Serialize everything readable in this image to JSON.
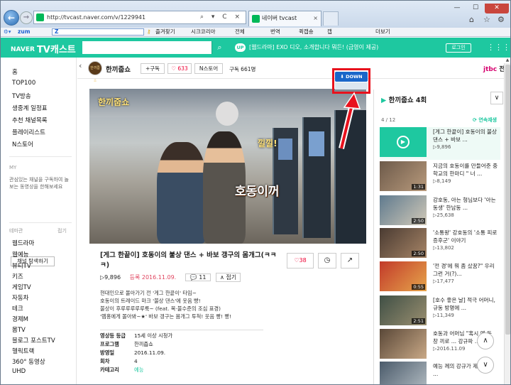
{
  "browser": {
    "url": "http://tvcast.naver.com/v/1229941",
    "tab_title": "네이버 tvcast",
    "tab_close": "×",
    "back_glyph": "←",
    "forward_glyph": "→",
    "addr_controls": "⌕ ▾ C ×",
    "min_glyph": "—",
    "max_glyph": "☐",
    "close_glyph": "✕"
  },
  "toolbar": {
    "zum": "zum",
    "z_label": "Z",
    "items": [
      "즐겨찾기",
      "시크코리아",
      "전체",
      "번역",
      "퀵캡숑",
      "캡",
      "더보기"
    ]
  },
  "site_header": {
    "logo_naver": "NAVER",
    "logo_service": "TV캐스트",
    "search_placeholder": "",
    "search_glyph": "⌕",
    "up_badge": "UP",
    "up_text": "[웹드라마] EXO 디오, 소개합니다 뭐든! (금영이 제공)",
    "login": "로그인",
    "grid_glyph": "⋮⋮⋮"
  },
  "sidebar": {
    "items": [
      "홈",
      "TOP100",
      "TV방송",
      "생중계 일정표",
      "추천 채널목록",
      "플레이리스트",
      "N스토어"
    ],
    "my_label": "MY",
    "my_desc": "관심있는 채널을 구독하여 놀 보는 동영상을 한해보세요",
    "channel_btn": "채널 탐색하기",
    "theme_label": "테마관",
    "theme_fold": "접기",
    "theme_items": [
      "웹드라마",
      "웹예능",
      "뷰티TV",
      "키즈",
      "게임TV",
      "자동차",
      "테크",
      "경제M",
      "몸TV",
      "블로그 포스트TV",
      "헬릭트랙",
      "360° 동영상",
      "UHD"
    ]
  },
  "channel": {
    "name": "한끼줍쇼",
    "logo_text": "한끼줍쇼",
    "subscribe": "+구독",
    "likes": "♡ 633",
    "nstore": "N스토어",
    "subscribers": "구독 661명",
    "broadcaster": "jtbc",
    "broadcaster_rest": " 전체보기",
    "prev_glyph": "‹"
  },
  "player": {
    "watermark": "한끼줍쇼",
    "caption_top": "낄낄!",
    "caption_main": "호동이꺼",
    "download_label": "DOWN"
  },
  "video": {
    "title": "[게그 한끝이] 호동이의 불상 댄스 + 바보 갱구의 몸개그(ㅋㅋㅋ)",
    "views": "▷9,896",
    "date": "등록 2016.11.09.",
    "comments": "11",
    "fold": "∧ 접기",
    "like_count": "♡38",
    "clock_glyph": "◷",
    "share_glyph": "↗",
    "desc": [
      "현대인으로 몰아가기 전 '게그 한끝이' 타임~",
      "호동이의 트레이드 마크 '불상 댄스'에 웃음 빵!",
      "불상이 후루루루루루룩~ (feat. 목·불수준의 조심 표경)",
      "'멤홍에게 몰아봐~★' 바보 갱구는 몸개그 투척! 웃음 빵! 빵!"
    ],
    "info": [
      {
        "k": "영상등 등급",
        "v": "15세 이상 시청가"
      },
      {
        "k": "프로그램",
        "v": "한끼줍쇼"
      },
      {
        "k": "방영일",
        "v": "2016.11.09."
      },
      {
        "k": "회차",
        "v": "4"
      },
      {
        "k": "카테고리",
        "v": "예능"
      }
    ]
  },
  "playlist": {
    "title": "한끼줍쇼 4회",
    "title_badge": "",
    "count": "4 / 12",
    "autoplay": "연속재생",
    "collapse_glyph": "∨",
    "items": [
      {
        "title": "[게그 한끝이] 호동이의 불상 댄스 + 바보 ...",
        "views": "▷9,896",
        "dur": "",
        "current": true
      },
      {
        "title": "지금의 호동이를 만들어준 중학교의 한마디 \" 너 ...",
        "views": "▷8,149",
        "dur": "1:31",
        "current": false
      },
      {
        "title": "강호동, 아는 형님보다 '아는 동생' 한남동 ...",
        "views": "▷25,638",
        "dur": "2:50",
        "current": false
      },
      {
        "title": "'소통왕' 강호동의 '소통 피로증후군' 이야기",
        "views": "▷13,802",
        "dur": "2:50",
        "current": false
      },
      {
        "title": "'전 경'에 뭐 좀 샀꿈?\" 우리 그런 거(?)...",
        "views": "▷17,477",
        "dur": "0:55",
        "current": false
      },
      {
        "title": "[호수 좋은 날] 적극 어머니, 규동 방명에 ...",
        "views": "▷11,349",
        "dur": "2:51",
        "current": false
      },
      {
        "title": "호동과 어머님 \"혹시 옛 동창 끼로 ... 강규파 ...",
        "views": "▷2016.11.09",
        "dur": "",
        "current": false
      },
      {
        "title": "예능 께의 강규가 제안하는 ...",
        "views": "",
        "dur": "",
        "current": false
      }
    ],
    "up_glyph": "∧",
    "down_glyph": "∨"
  }
}
